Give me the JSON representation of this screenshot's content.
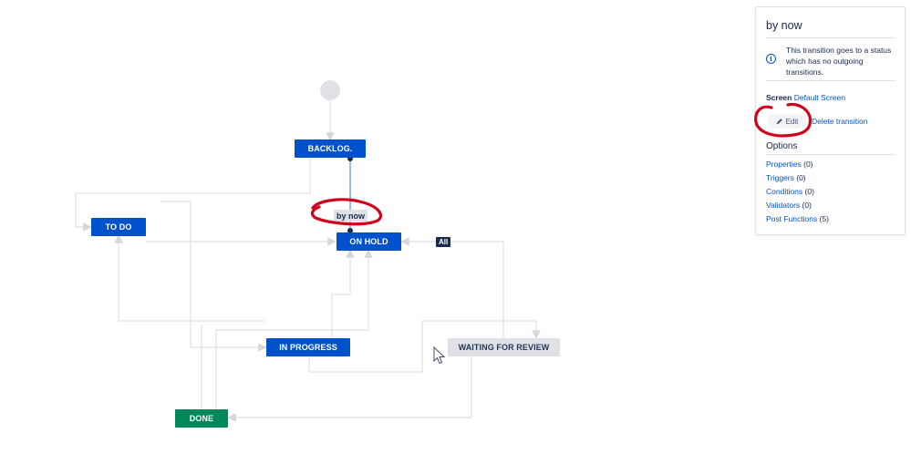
{
  "diagram": {
    "start": {
      "name": "start-node"
    },
    "statuses": [
      {
        "id": "backlog",
        "label": "BACKLOG.",
        "color": "#0052cc",
        "text_color": "#ffffff"
      },
      {
        "id": "todo",
        "label": "TO DO",
        "color": "#0052cc",
        "text_color": "#ffffff"
      },
      {
        "id": "on_hold",
        "label": "ON HOLD",
        "color": "#0052cc",
        "text_color": "#ffffff"
      },
      {
        "id": "in_progress",
        "label": "IN PROGRESS",
        "color": "#0052cc",
        "text_color": "#ffffff"
      },
      {
        "id": "waiting_for_review",
        "label": "WAITING FOR REVIEW",
        "color": "#dfe1e6",
        "text_color": "#253858"
      },
      {
        "id": "done",
        "label": "DONE",
        "color": "#00875a",
        "text_color": "#ffffff"
      }
    ],
    "transition_label": "by now",
    "all_label": "All"
  },
  "panel": {
    "title": "by now",
    "info_icon": "info-icon",
    "info_text": "This transition goes to a status which has no outgoing transitions.",
    "screen_label": "Screen",
    "screen_value": "Default Screen",
    "edit_label": "Edit",
    "edit_icon": "pencil-icon",
    "delete_label": "Delete transition",
    "options_title": "Options",
    "options": [
      {
        "label": "Properties",
        "count": "(0)"
      },
      {
        "label": "Triggers",
        "count": "(0)"
      },
      {
        "label": "Conditions",
        "count": "(0)"
      },
      {
        "label": "Validators",
        "count": "(0)"
      },
      {
        "label": "Post Functions",
        "count": "(5)"
      }
    ]
  },
  "colors": {
    "link": "#0052cc",
    "connector": "#dfe1e6",
    "selected_connector": "#0052cc",
    "annotation": "#d0021b"
  }
}
